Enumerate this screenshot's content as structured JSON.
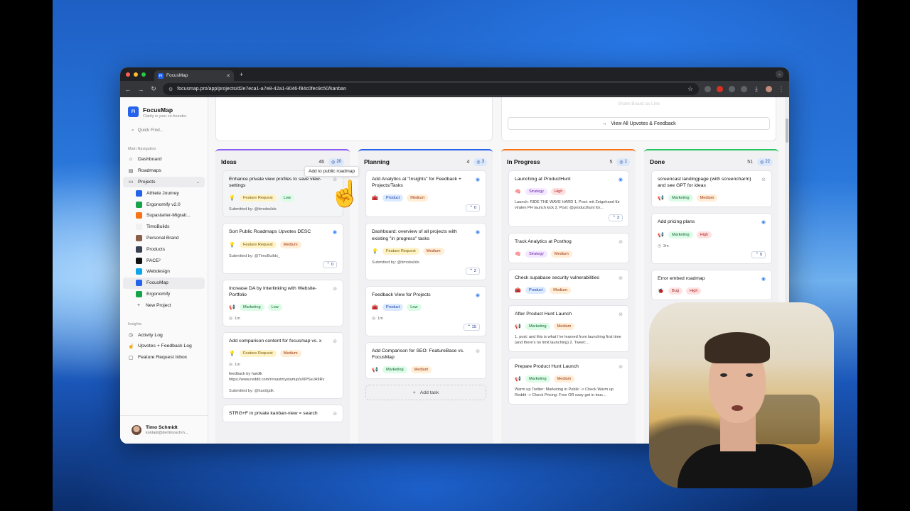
{
  "browser": {
    "tab_title": "FocusMap",
    "tab_favicon": "FI",
    "url": "focusmap.pro/app/projects/d2e7eca1-a7e8-42a1-9046-f84c0fec9c50/kanban"
  },
  "sidebar": {
    "brand_logo": "FI",
    "brand_name": "FocusMap",
    "brand_sub": "Clarity is your co-founder.",
    "quick_find": "Quick Find...",
    "main_nav_label": "Main Navigation",
    "nav": [
      {
        "label": "Dashboard",
        "icon": "home-icon"
      },
      {
        "label": "Roadmaps",
        "icon": "map-icon"
      },
      {
        "label": "Projects",
        "icon": "folder-icon"
      }
    ],
    "projects": [
      {
        "label": "Athlete Journey",
        "color": "#2563eb"
      },
      {
        "label": "Ergonomify v2.0",
        "color": "#16a34a"
      },
      {
        "label": "Supastarter-Migrati...",
        "color": "#f97316"
      },
      {
        "label": "TimoBuilds",
        "color": "#f1f1f1"
      },
      {
        "label": "Personal Brand",
        "color": "#8b5e4a"
      },
      {
        "label": "Products",
        "color": "#374151"
      },
      {
        "label": "PACE²",
        "color": "#111111"
      },
      {
        "label": "Webdesign",
        "color": "#0ea5e9"
      },
      {
        "label": "FocusMap",
        "color": "#2563eb"
      },
      {
        "label": "Ergonomify",
        "color": "#16a34a"
      }
    ],
    "new_project": "New Project",
    "insights_label": "Insights",
    "insights": [
      {
        "label": "Activity Log"
      },
      {
        "label": "Upvotes + Feedback Log"
      },
      {
        "label": "Feature Request Inbox"
      }
    ],
    "user_name": "Timo Schmidt",
    "user_email": "kontakt@dertimoschm..."
  },
  "top": {
    "faded_button": "Share Board as Link",
    "upvotes_button": "View All Upvotes & Feedback"
  },
  "columns": [
    {
      "title": "Ideas",
      "count": "46",
      "upvotes": "20",
      "color": "#8b5cf6",
      "cards": [
        {
          "title": "Enhance private view profiles to save view-settings",
          "visible": false,
          "tag_icon": "💡",
          "tag1": "Feature Request",
          "tag2": "Low",
          "submitted": "Submitted by: @timobuilds"
        },
        {
          "title": "Sort Public Roadmaps Upvotes DESC",
          "visible": true,
          "tag_icon": "💡",
          "tag1": "Feature Request",
          "tag2": "Medium",
          "submitted": "Submitted by: @TimoBuilds_",
          "votes": "0"
        },
        {
          "title": "Increase DA by Interlinking with Website-Portfolio",
          "visible": false,
          "tag_icon": "📢",
          "tag1": "Marketing",
          "tag2": "Low",
          "meta": "1m"
        },
        {
          "title": "Add comparison content for focusmap vs. x",
          "visible": false,
          "tag_icon": "💡",
          "tag1": "Feature Request",
          "tag2": "Medium",
          "meta": "1m",
          "desc": "feedback by hardik https://www.reddit.com/r/roastmystartup/s/0PSeJA9Rv",
          "submitted": "Submitted by: @hardigdk"
        },
        {
          "title": "STRG+F in private kanban-view = search",
          "visible": false
        }
      ]
    },
    {
      "title": "Planning",
      "count": "4",
      "upvotes": "3",
      "color": "#2563eb",
      "cards": [
        {
          "title": "Add Analytics at \"Insights\" for Feedback + Projects/Tasks",
          "visible": true,
          "tag_icon": "🧰",
          "tag1": "Product",
          "tag2": "Medium",
          "votes": "0"
        },
        {
          "title": "Dashboard: overview of all projects with existing \"in progress\" tasks",
          "visible": true,
          "tag_icon": "💡",
          "tag1": "Feature Request",
          "tag2": "Medium",
          "submitted": "Submitted by: @timobuilds",
          "votes": "2"
        },
        {
          "title": "Feedback View for Projects",
          "visible": true,
          "tag_icon": "🧰",
          "tag1": "Product",
          "tag2": "Low",
          "meta": "1m",
          "votes": "15"
        },
        {
          "title": "Add Comparison for SEO: FeatureBase vs. FocusMap",
          "visible": false,
          "tag_icon": "📢",
          "tag1": "Marketing",
          "tag2": "Medium"
        }
      ],
      "add_task": "Add task"
    },
    {
      "title": "In Progress",
      "count": "5",
      "upvotes": "1",
      "color": "#f97316",
      "cards": [
        {
          "title": "Launching at ProductHunt",
          "visible": true,
          "tag_icon": "🧠",
          "tag1": "Strategy",
          "tag2": "High",
          "desc": "Launch: RIDE THE WAVE HARD 1. Post: mit Zeigehand für viralen PH launch kick 2. Post: @producthunt for...",
          "votes": "3"
        },
        {
          "title": "Track Analytics at Posthog",
          "visible": false,
          "tag_icon": "🧠",
          "tag1": "Strategy",
          "tag2": "Medium"
        },
        {
          "title": "Check supabase security vulnerabilities",
          "visible": false,
          "tag_icon": "🧰",
          "tag1": "Product",
          "tag2": "Medium"
        },
        {
          "title": "After Product Hunt Launch",
          "visible": false,
          "tag_icon": "📢",
          "tag1": "Marketing",
          "tag2": "Medium",
          "desc": "1. post: and this is what I've learned from launching first time (and there's no limit launching) 2. Tweet:..."
        },
        {
          "title": "Prepare Product Hunt Launch",
          "visible": false,
          "tag_icon": "📢",
          "tag1": "Marketing",
          "tag2": "Medium",
          "desc": "Warm up Twitter: Marketing in Public -> Check Warm up Reddit -> Check Pricing: Free OR easy get in touc..."
        }
      ]
    },
    {
      "title": "Done",
      "count": "51",
      "upvotes": "22",
      "color": "#22c55e",
      "cards": [
        {
          "title": "screencast landingpage (with screencharm) and see GPT for ideas",
          "visible": false,
          "tag_icon": "📢",
          "tag1": "Marketing",
          "tag2": "Medium"
        },
        {
          "title": "Add pricing plans",
          "visible": true,
          "tag_icon": "📢",
          "tag1": "Marketing",
          "tag2": "High",
          "meta": "3m",
          "votes": "9"
        },
        {
          "title": "Error embed roadmap",
          "visible": true,
          "tag_icon": "🐞",
          "tag1": "Bug",
          "tag2": "High"
        }
      ]
    }
  ],
  "tooltip": "Add to public roadmap",
  "tag_colors": {
    "Feature Request": {
      "bg": "#fef3c7",
      "fg": "#7c5a06"
    },
    "Marketing": {
      "bg": "#dcfce7",
      "fg": "#166534"
    },
    "Product": {
      "bg": "#dbeafe",
      "fg": "#1e40af"
    },
    "Strategy": {
      "bg": "#f3e8ff",
      "fg": "#6b21a8"
    },
    "Bug": {
      "bg": "#fee2e2",
      "fg": "#991b1b"
    },
    "Low": {
      "bg": "#dcfce7",
      "fg": "#166534"
    },
    "Medium": {
      "bg": "#ffedd5",
      "fg": "#9a3412"
    },
    "High": {
      "bg": "#fee2e2",
      "fg": "#b91c1c"
    }
  }
}
